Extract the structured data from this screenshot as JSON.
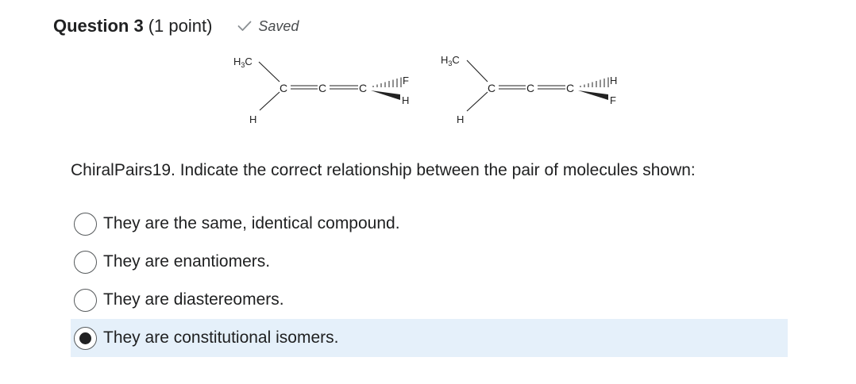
{
  "question": {
    "title": "Question 3",
    "points": "(1 point)",
    "status": "Saved",
    "status_icon": "checkmark-icon",
    "status_color": "#8a8f93"
  },
  "structures": {
    "molecule_left": {
      "top_group": "H3C",
      "bottom_group": "H",
      "carbon_chain": [
        "C",
        "C",
        "C"
      ],
      "hashed_substituent": "F",
      "wedged_substituent": "H"
    },
    "molecule_right": {
      "top_group": "H3C",
      "bottom_group": "H",
      "carbon_chain": [
        "C",
        "C",
        "C"
      ],
      "hashed_substituent": "H",
      "wedged_substituent": "F"
    }
  },
  "prompt": "ChiralPairs19. Indicate the correct relationship between the pair of molecules shown:",
  "options": [
    {
      "label": "They are the same, identical compound.",
      "selected": false
    },
    {
      "label": "They are enantiomers.",
      "selected": false
    },
    {
      "label": "They are diastereomers.",
      "selected": false
    },
    {
      "label": "They are constitutional isomers.",
      "selected": true
    }
  ],
  "colors": {
    "selected_background": "#e5f0fa",
    "text": "#202122"
  }
}
